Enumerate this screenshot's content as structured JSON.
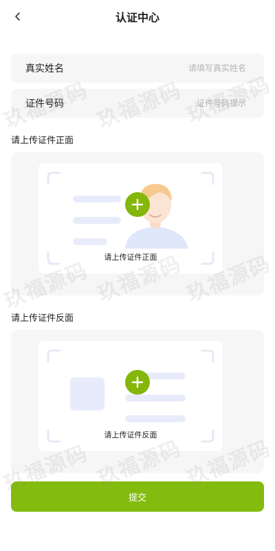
{
  "header": {
    "title": "认证中心"
  },
  "form": {
    "name": {
      "label": "真实姓名",
      "placeholder": "请填写真实姓名",
      "value": ""
    },
    "id_number": {
      "label": "证件号码",
      "placeholder": "证件号码提示",
      "value": ""
    }
  },
  "upload_front": {
    "section_title": "请上传证件正面",
    "card_label": "请上传证件正面"
  },
  "upload_back": {
    "section_title": "请上传证件反面",
    "card_label": "请上传证件反面"
  },
  "submit": {
    "label": "提交"
  },
  "watermark": {
    "text": "玖福源码"
  },
  "colors": {
    "accent": "#84BB0F",
    "field_bg": "#F6F6F6",
    "placeholder": "#B6B6B6"
  },
  "icons": {
    "back": "chevron-left-icon",
    "plus": "plus-icon",
    "avatar": "person-icon"
  }
}
